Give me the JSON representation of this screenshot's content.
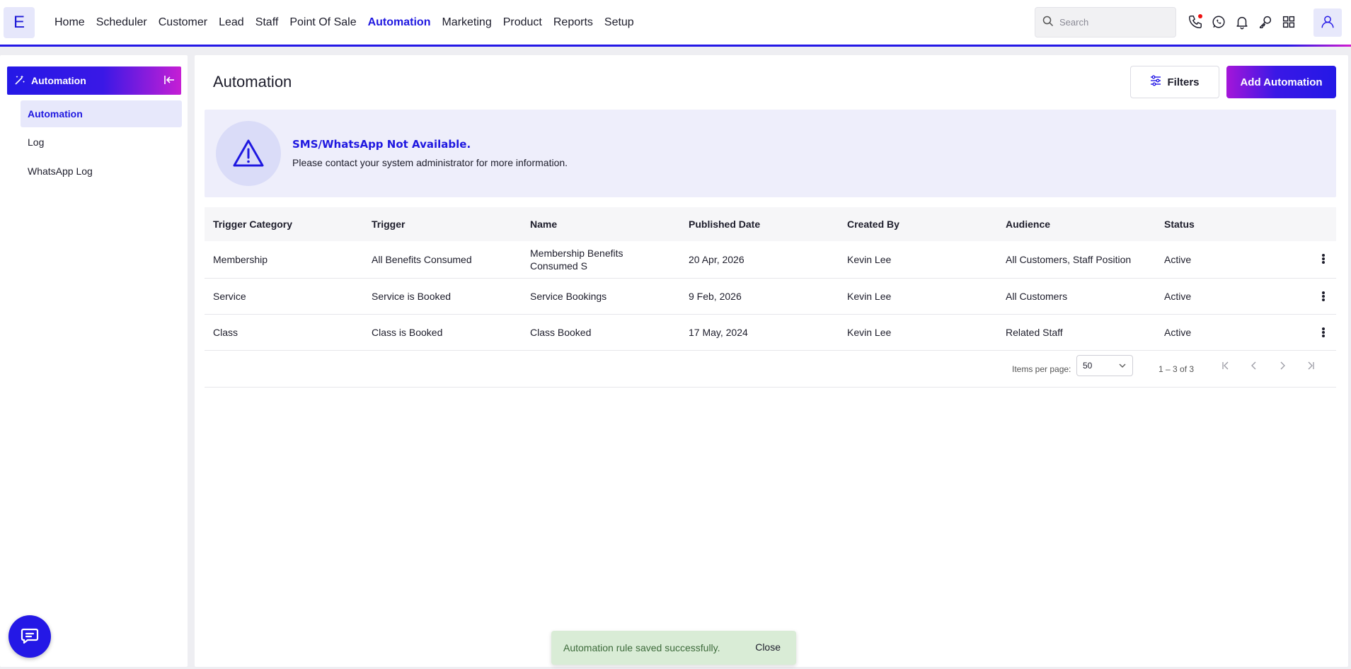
{
  "brand": {
    "logo_letter": "E",
    "accent": "#2418e6",
    "accent_gradient_end": "#c61fd4"
  },
  "nav": {
    "items": [
      {
        "label": "Home"
      },
      {
        "label": "Scheduler"
      },
      {
        "label": "Customer"
      },
      {
        "label": "Lead"
      },
      {
        "label": "Staff"
      },
      {
        "label": "Point Of Sale"
      },
      {
        "label": "Automation",
        "active": true
      },
      {
        "label": "Marketing"
      },
      {
        "label": "Product"
      },
      {
        "label": "Reports"
      },
      {
        "label": "Setup"
      }
    ]
  },
  "search": {
    "placeholder": "Search"
  },
  "top_icons": [
    "phone-icon",
    "whatsapp-icon",
    "bell-icon",
    "key-icon",
    "grid-icon",
    "user-icon"
  ],
  "sidebar": {
    "header": "Automation",
    "items": [
      {
        "label": "Automation",
        "active": true
      },
      {
        "label": "Log"
      },
      {
        "label": "WhatsApp Log"
      }
    ]
  },
  "main": {
    "title": "Automation",
    "filters_label": "Filters",
    "add_label": "Add Automation"
  },
  "alert": {
    "title": "SMS/WhatsApp Not Available.",
    "text": "Please contact your system administrator for more information."
  },
  "table": {
    "columns": [
      "Trigger Category",
      "Trigger",
      "Name",
      "Published Date",
      "Created By",
      "Audience",
      "Status"
    ],
    "rows": [
      [
        "Membership",
        "All Benefits Consumed",
        "Membership Benefits Consumed S",
        "20 Apr, 2026",
        "Kevin Lee",
        "All Customers, Staff Position",
        "Active"
      ],
      [
        "Service",
        "Service is Booked",
        "Service Bookings",
        "9 Feb, 2026",
        "Kevin Lee",
        "All Customers",
        "Active"
      ],
      [
        "Class",
        "Class is Booked",
        "Class Booked",
        "17 May, 2024",
        "Kevin Lee",
        "Related Staff",
        "Active"
      ]
    ]
  },
  "paginator": {
    "label": "Items per page:",
    "page_size": "50",
    "range": "1 – 3 of 3"
  },
  "toast": {
    "message": "Automation rule saved successfully.",
    "action": "Close"
  }
}
